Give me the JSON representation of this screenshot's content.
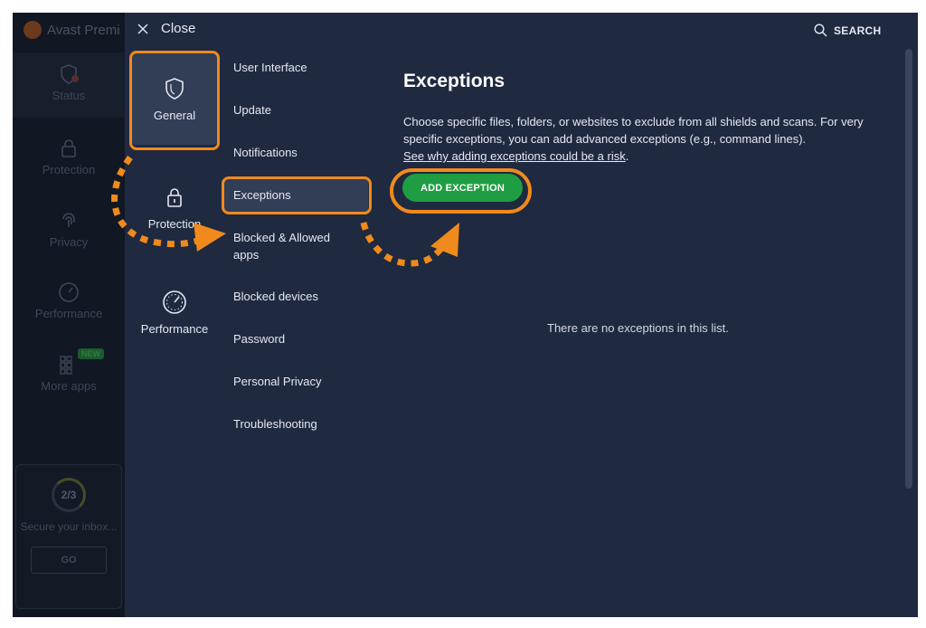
{
  "app": {
    "brand": "Avast Premi",
    "rail": [
      {
        "label": "Status"
      },
      {
        "label": "Protection"
      },
      {
        "label": "Privacy"
      },
      {
        "label": "Performance"
      },
      {
        "label": "More apps"
      }
    ],
    "new_badge": "NEW",
    "promo": {
      "progress": "2/3",
      "text": "Secure your inbox...",
      "button": "GO"
    }
  },
  "header": {
    "close_label": "Close",
    "search_label": "SEARCH"
  },
  "categories": [
    {
      "label": "General",
      "icon": "shield-icon"
    },
    {
      "label": "Protection",
      "icon": "lock-icon"
    },
    {
      "label": "Performance",
      "icon": "speedometer-icon"
    }
  ],
  "submenu": [
    {
      "label": "User Interface"
    },
    {
      "label": "Update"
    },
    {
      "label": "Notifications"
    },
    {
      "label": "Exceptions"
    },
    {
      "label": "Blocked & Allowed apps"
    },
    {
      "label": "Blocked devices"
    },
    {
      "label": "Password"
    },
    {
      "label": "Personal Privacy"
    },
    {
      "label": "Troubleshooting"
    }
  ],
  "content": {
    "title": "Exceptions",
    "description": "Choose specific files, folders, or websites to exclude from all shields and scans. For very specific exceptions, you can add advanced exceptions (e.g., command lines).",
    "risk_link": "See why adding exceptions could be a risk",
    "add_button": "ADD EXCEPTION",
    "empty_text": "There are no exceptions in this list."
  },
  "colors": {
    "accent": "#f08a1c",
    "button": "#1f9d43",
    "background": "#1f2940",
    "selected": "#323d56"
  }
}
